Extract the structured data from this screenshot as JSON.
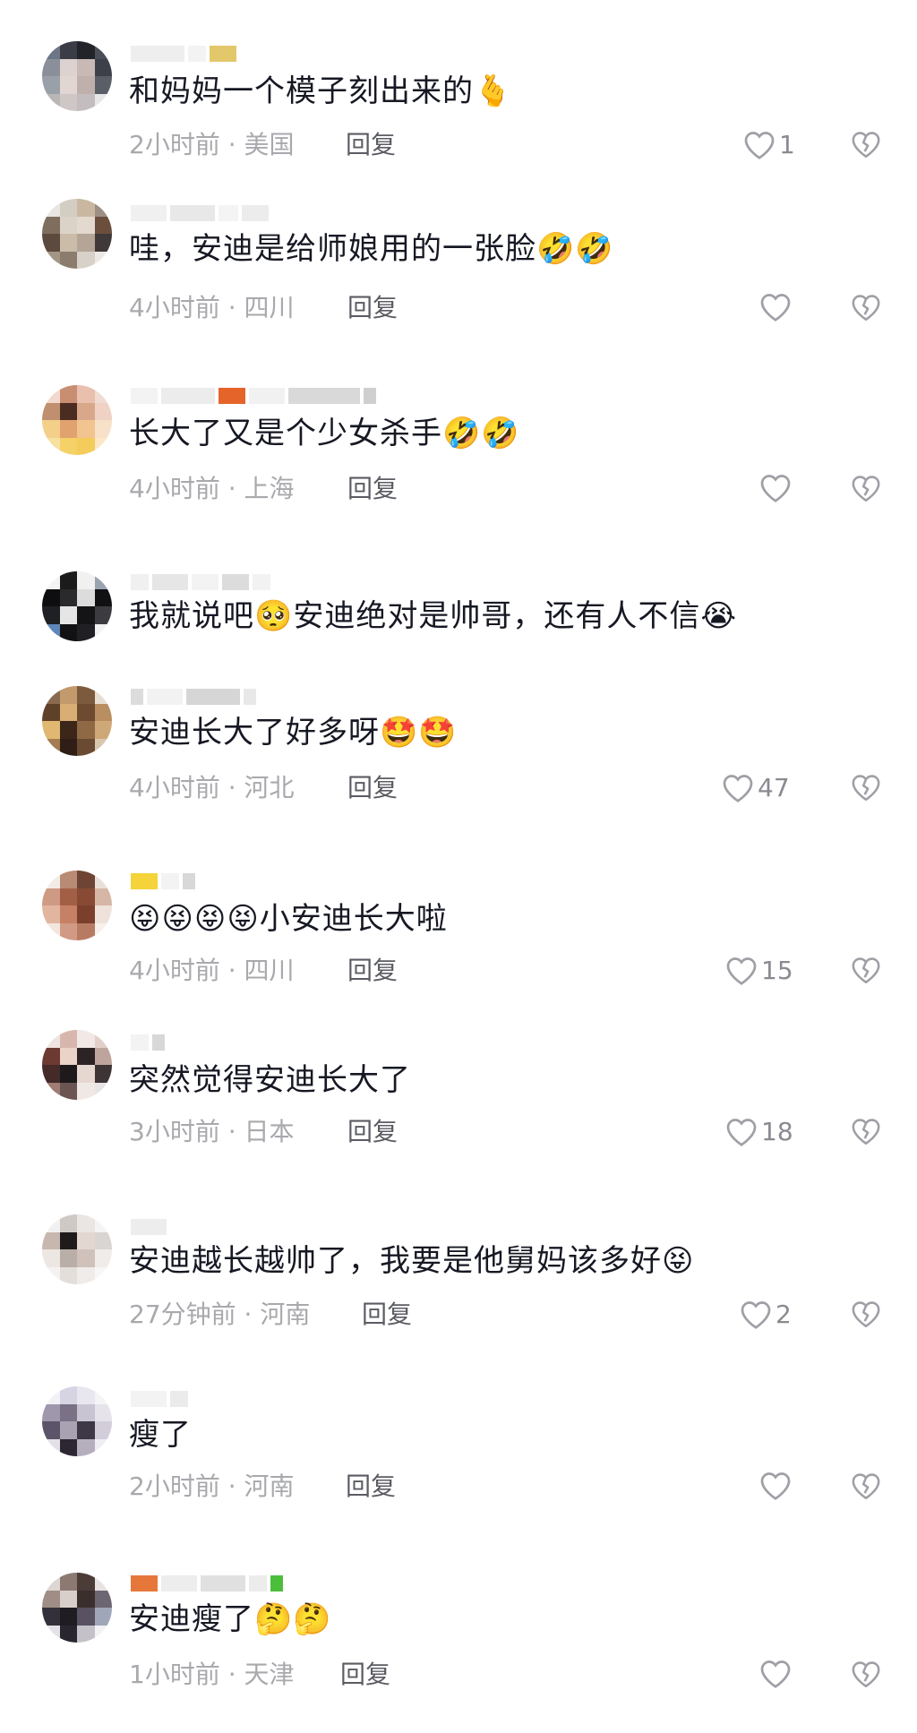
{
  "comments": [
    {
      "text": "和妈妈一个模子刻出来的",
      "emoji": "🫰",
      "time": "2小时前",
      "location": "美国",
      "reply": "回复",
      "likes": "1"
    },
    {
      "text": "哇，安迪是给师娘用的一张脸",
      "emoji": "🤣🤣",
      "time": "4小时前",
      "location": "四川",
      "reply": "回复",
      "likes": ""
    },
    {
      "text": "长大了又是个少女杀手",
      "emoji": "🤣🤣",
      "time": "4小时前",
      "location": "上海",
      "reply": "回复",
      "likes": ""
    },
    {
      "text_a": "我就说吧",
      "emoji_a": "🥺",
      "text_b": "安迪绝对是帅哥，还有人不信",
      "emoji_b": "😭"
    },
    {
      "text": "安迪长大了好多呀",
      "emoji": "🤩🤩",
      "time": "4小时前",
      "location": "河北",
      "reply": "回复",
      "likes": "47"
    },
    {
      "emoji_prefix": "😝😝😝😝",
      "text": "小安迪长大啦",
      "time": "4小时前",
      "location": "四川",
      "reply": "回复",
      "likes": "15"
    },
    {
      "text": "突然觉得安迪长大了",
      "time": "3小时前",
      "location": "日本",
      "reply": "回复",
      "likes": "18"
    },
    {
      "text": "安迪越长越帅了，我要是他舅妈该多好",
      "emoji": "😝",
      "time": "27分钟前",
      "location": "河南",
      "reply": "回复",
      "likes": "2"
    },
    {
      "text": "瘦了",
      "time": "2小时前",
      "location": "河南",
      "reply": "回复",
      "likes": ""
    },
    {
      "text": "安迪瘦了",
      "emoji": "🤔🤔",
      "time": "1小时前",
      "location": "天津",
      "reply": "回复",
      "likes": ""
    }
  ],
  "icons": {
    "like": "heart-outline-icon",
    "dislike": "broken-heart-icon"
  },
  "colors": {
    "text": "#161823",
    "meta": "#a8a9ad",
    "reply": "#5b5c63",
    "icon": "#9fa0a6"
  },
  "separator": " · "
}
